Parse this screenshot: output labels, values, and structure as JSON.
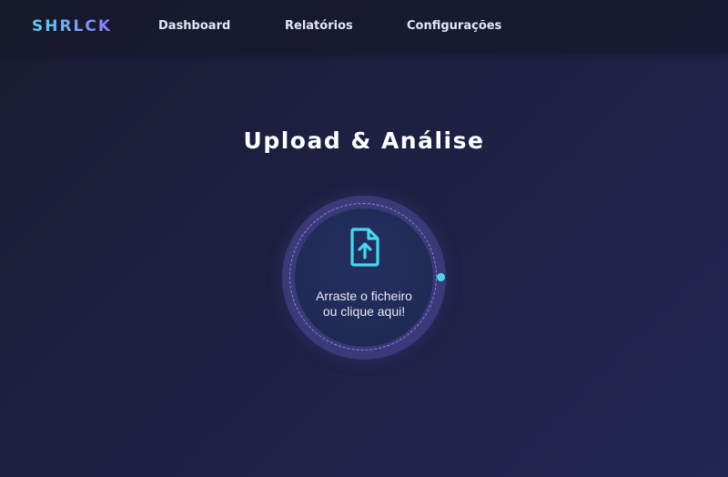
{
  "nav": {
    "brand": "SHRLCK",
    "links": [
      {
        "label": "Dashboard"
      },
      {
        "label": "Relatórios"
      },
      {
        "label": "Configurações"
      }
    ]
  },
  "main": {
    "title": "Upload & Análise",
    "upload": {
      "line1": "Arraste o ficheiro",
      "line2": "ou clique aqui!",
      "icon": "file-upload-icon"
    }
  },
  "colors": {
    "accent_cyan": "#49d6ee",
    "accent_purple": "#8b7bff",
    "background": "#1f2145"
  }
}
